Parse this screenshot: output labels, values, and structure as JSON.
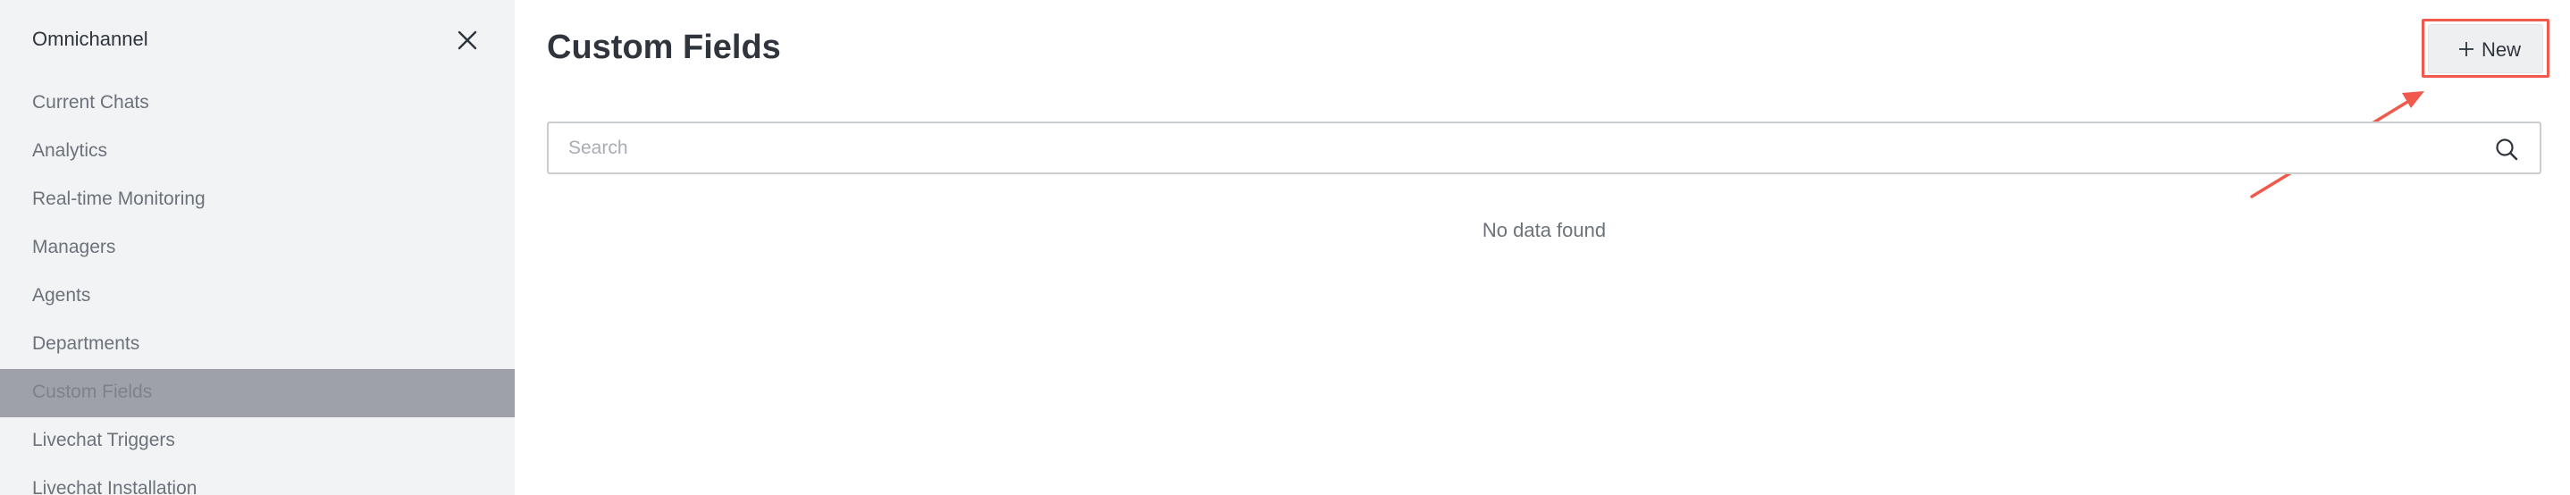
{
  "sidebar": {
    "title": "Omnichannel",
    "items": [
      {
        "label": "Current Chats"
      },
      {
        "label": "Analytics"
      },
      {
        "label": "Real-time Monitoring"
      },
      {
        "label": "Managers"
      },
      {
        "label": "Agents"
      },
      {
        "label": "Departments"
      },
      {
        "label": "Custom Fields",
        "active": true
      },
      {
        "label": "Livechat Triggers"
      },
      {
        "label": "Livechat Installation"
      }
    ]
  },
  "main": {
    "title": "Custom Fields",
    "new_button_label": "New",
    "search": {
      "placeholder": "Search",
      "value": ""
    },
    "empty_message": "No data found"
  },
  "icons": {
    "close": "close-icon",
    "plus": "plus-icon",
    "search": "search-icon"
  },
  "colors": {
    "sidebar_bg": "#f2f3f5",
    "active_item_bg": "#9ea2a8",
    "annotation": "#ef5a4c",
    "text_primary": "#2f343d",
    "text_secondary": "#6c727a"
  }
}
